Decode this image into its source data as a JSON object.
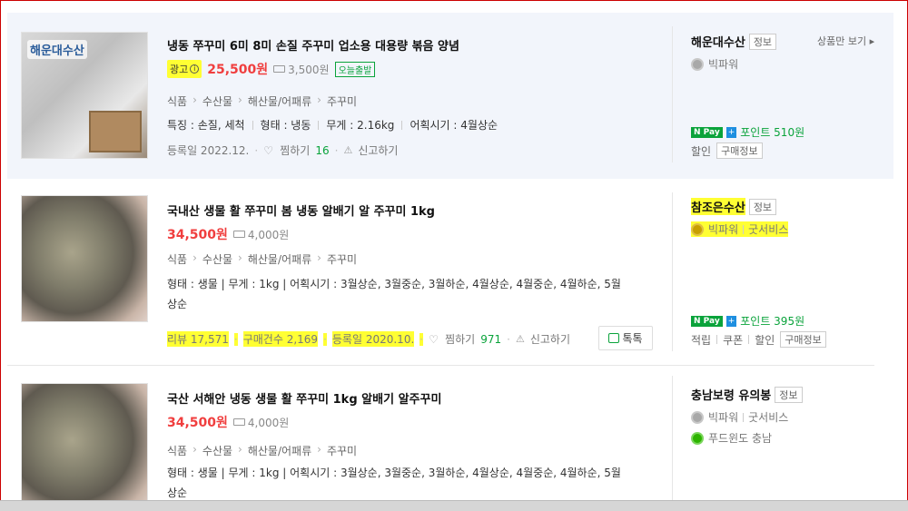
{
  "items": [
    {
      "ad_label": "광고",
      "title": "냉동 쭈꾸미 6미 8미 손질 주꾸미 업소용 대용량 볶음 양념",
      "price": "25,500원",
      "shipping": "3,500원",
      "badge": "오늘출발",
      "thumb_logo": "해운대수산",
      "category": [
        "식품",
        "수산물",
        "해산물/어패류",
        "주꾸미"
      ],
      "specs": [
        "특징 : 손질, 세척",
        "형태 : 냉동",
        "무게 : 2.16kg",
        "어획시기 : 4월상순"
      ],
      "registered": "등록일 2022.12.",
      "wish_label": "찜하기",
      "wish_count": "16",
      "report": "신고하기",
      "seller": "해운대수산",
      "seller_tag": "정보",
      "more_link": "상품만 보기",
      "grade": "빅파워",
      "npay": "N Pay",
      "point": "포인트 510원",
      "benefits": [
        "할인"
      ],
      "purchase_info": "구매정보"
    },
    {
      "title": "국내산 생물 활 쭈꾸미 봄 냉동 알배기 알 주꾸미 1kg",
      "price": "34,500원",
      "shipping": "4,000원",
      "category": [
        "식품",
        "수산물",
        "해산물/어패류",
        "주꾸미"
      ],
      "spec_text": "형태 : 생물  |  무게 : 1kg  |  어획시기 : 3월상순, 3월중순, 3월하순, 4월상순, 4월중순, 4월하순, 5월상순",
      "review": "리뷰 17,571",
      "purchases": "구매건수 2,169",
      "registered": "등록일 2020.10.",
      "wish_label": "찜하기",
      "wish_count": "971",
      "report": "신고하기",
      "talk": "톡톡",
      "seller": "참조은수산",
      "seller_tag": "정보",
      "grade": "빅파워",
      "service": "굿서비스",
      "npay": "N Pay",
      "point": "포인트 395원",
      "benefits": [
        "적립",
        "쿠폰",
        "할인"
      ],
      "purchase_info": "구매정보"
    },
    {
      "title": "국산 서해안 냉동 생물 활 쭈꾸미 1kg 알배기 알주꾸미",
      "price": "34,500원",
      "shipping": "4,000원",
      "category": [
        "식품",
        "수산물",
        "해산물/어패류",
        "주꾸미"
      ],
      "spec_text": "형태 : 생물  |  무게 : 1kg  |  어획시기 : 3월상순, 3월중순, 3월하순, 4월상순, 4월중순, 4월하순, 5월상순",
      "seller": "충남보령 유의봉",
      "seller_tag": "정보",
      "grade": "빅파워",
      "service": "굿서비스",
      "origin": "푸드윈도 충남"
    }
  ],
  "colors": {
    "price": "#f03e3e",
    "green": "#0aa33b",
    "highlight": "#ffff33"
  }
}
